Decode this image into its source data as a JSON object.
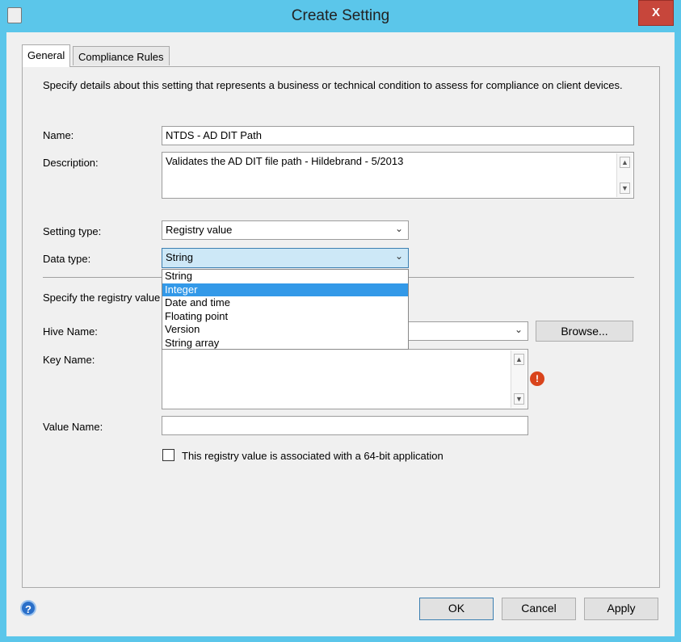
{
  "window": {
    "title": "Create Setting",
    "close_label": "X"
  },
  "tabs": [
    {
      "label": "General",
      "active": true
    },
    {
      "label": "Compliance Rules",
      "active": false
    }
  ],
  "intro": "Specify details about this setting that represents a business or technical condition to assess for compliance on client devices.",
  "form": {
    "name_label": "Name:",
    "name_value": "NTDS - AD DIT Path",
    "description_label": "Description:",
    "description_value": "Validates the AD DIT file path - Hildebrand - 5/2013",
    "setting_type_label": "Setting type:",
    "setting_type_value": "Registry value",
    "data_type_label": "Data type:",
    "data_type_value": "String",
    "data_type_options": [
      "String",
      "Integer",
      "Date and time",
      "Floating point",
      "Version",
      "String array"
    ],
    "data_type_highlighted": "Integer",
    "registry_intro": "Specify the registry value",
    "hive_label": "Hive Name:",
    "hive_value": "",
    "browse_label": "Browse...",
    "key_label": "Key Name:",
    "key_value": "",
    "value_name_label": "Value Name:",
    "value_name_value": "",
    "checkbox_label": "This registry value is associated with a 64-bit application",
    "checkbox_checked": false
  },
  "footer": {
    "ok": "OK",
    "cancel": "Cancel",
    "apply": "Apply"
  },
  "colors": {
    "titlebar": "#5bc6ea",
    "close": "#c7463b",
    "highlight": "#3399e8",
    "error": "#d9441c"
  }
}
